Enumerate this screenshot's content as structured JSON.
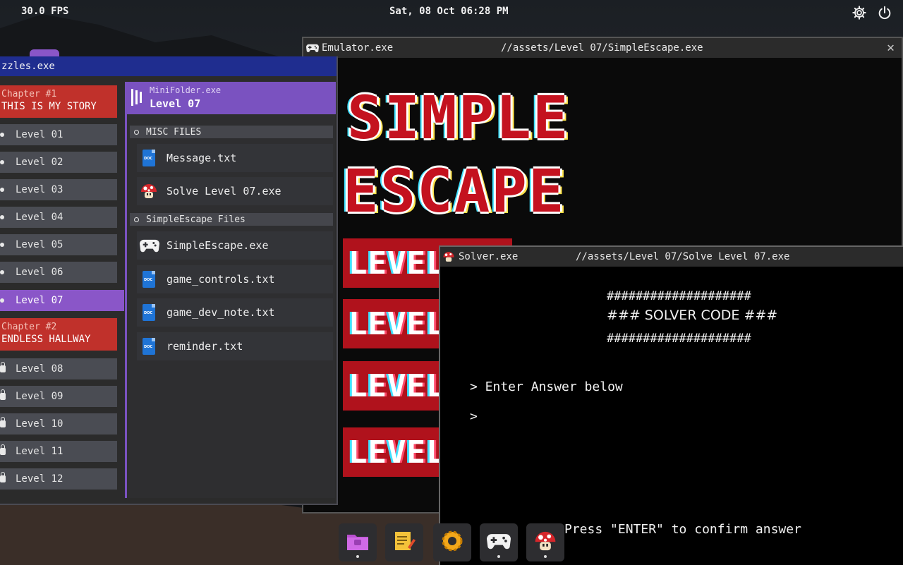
{
  "topbar": {
    "fps": "30.0 FPS",
    "datetime": "Sat, 08 Oct 06:28 PM",
    "icons": [
      "gear-icon",
      "power-icon"
    ]
  },
  "puzzles": {
    "title": "zzles.exe",
    "chapters": [
      {
        "number": "Chapter #1",
        "title": "THIS IS MY STORY"
      },
      {
        "number": "Chapter #2",
        "title": "ENDLESS HALLWAY"
      }
    ],
    "levels": [
      "Level 01",
      "Level 02",
      "Level 03",
      "Level 04",
      "Level 05",
      "Level 06",
      "Level 07",
      "Level 08",
      "Level 09",
      "Level 10",
      "Level 11",
      "Level 12"
    ],
    "active_level": "Level 07",
    "folder": {
      "subtitle": "MiniFolder.exe",
      "title": "Level 07",
      "sections": [
        {
          "name": "MISC FILES",
          "files": [
            {
              "name": "Message.txt",
              "icon": "doc-icon"
            },
            {
              "name": "Solve Level 07.exe",
              "icon": "mushroom-icon"
            }
          ]
        },
        {
          "name": "SimpleEscape Files",
          "files": [
            {
              "name": "SimpleEscape.exe",
              "icon": "gamepad-icon"
            },
            {
              "name": "game_controls.txt",
              "icon": "doc-icon"
            },
            {
              "name": "game_dev_note.txt",
              "icon": "doc-icon"
            },
            {
              "name": "reminder.txt",
              "icon": "doc-icon"
            }
          ]
        }
      ]
    }
  },
  "emulator": {
    "title": "Emulator.exe",
    "path": "//assets/Level 07/SimpleEscape.exe",
    "game_title_line1": "SIMPLE",
    "game_title_line2": "ESCAPE",
    "level_button_text": "LEVEL"
  },
  "solver": {
    "title": "Solver.exe",
    "path": "//assets/Level 07/Solve Level 07.exe",
    "banner_border": "####################",
    "banner_text": "### SOLVER CODE ###",
    "prompt_line": "> Enter Answer below",
    "input_prompt": ">",
    "hint": "Press \"ENTER\" to confirm answer"
  },
  "dock": [
    "folder-icon",
    "notepad-icon",
    "settings-icon",
    "gamepad-icon",
    "mushroom-icon"
  ],
  "colors": {
    "chapter_red": "#c0312b",
    "accent_purple": "#8a56c8",
    "titlebar_blue": "#1f2d8f",
    "game_red": "#c4121f"
  }
}
